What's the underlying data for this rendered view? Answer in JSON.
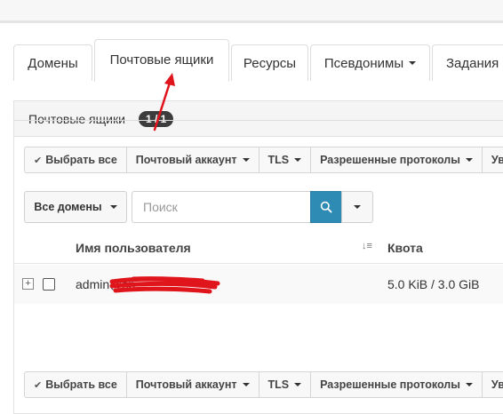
{
  "tabs": [
    {
      "label": "Домены",
      "active": false,
      "caret": false
    },
    {
      "label": "Почтовые ящики",
      "active": true,
      "caret": false
    },
    {
      "label": "Ресурсы",
      "active": false,
      "caret": false
    },
    {
      "label": "Псевдонимы",
      "active": false,
      "caret": true
    },
    {
      "label": "Задания",
      "active": false,
      "caret": false
    }
  ],
  "panel": {
    "title": "Почтовые ящики",
    "count": "1 / 1"
  },
  "toolbar": {
    "select_all": "Выбрать все",
    "mail_account": "Почтовый аккаунт",
    "tls": "TLS",
    "protocols": "Разрешенные протоколы",
    "more": "Ув"
  },
  "filter": {
    "domain_select": "Все домены",
    "search_placeholder": "Поиск"
  },
  "table": {
    "col_user": "Имя пользователя",
    "col_quota": "Квота",
    "rows": [
      {
        "username": "admin@sp",
        "quota": "5.0 KiB / 3.0 GiB"
      }
    ]
  },
  "colors": {
    "accent": "#2e8bb4",
    "annotation": "#e0141b",
    "badge": "#3c3c3c"
  },
  "icons": [
    "check-icon",
    "caret-down-icon",
    "search-icon",
    "sort-icon",
    "expand-icon",
    "annotation-arrow-icon",
    "redaction-scribble"
  ]
}
